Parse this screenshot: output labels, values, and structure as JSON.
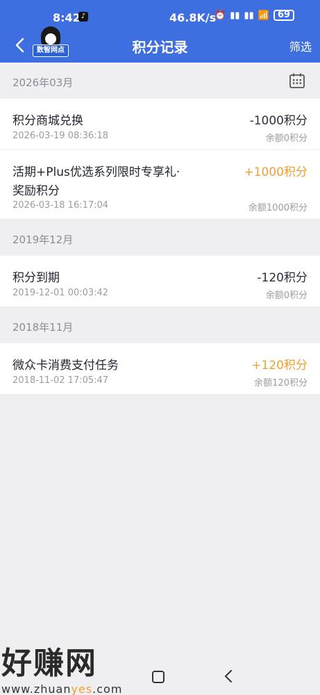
{
  "status_bar": {
    "time": "8:42",
    "network_speed": "46.8K/s",
    "battery": "69"
  },
  "header": {
    "title": "积分记录",
    "filter_label": "筛选",
    "logo_text": "数智网点"
  },
  "sections": [
    {
      "month": "2026年03月",
      "records": [
        {
          "title": "积分商城兑换",
          "date": "2026-03-19 08:36:18",
          "amount": "-1000积分",
          "balance": "余额0积分",
          "type": "negative"
        },
        {
          "title_line1": "活期+Plus优选系列限时专享礼·",
          "title_line2": "奖励积分",
          "date": "2026-03-18 16:17:04",
          "amount": "+1000积分",
          "balance": "余额1000积分",
          "type": "positive"
        }
      ]
    },
    {
      "month": "2019年12月",
      "records": [
        {
          "title": "积分到期",
          "date": "2019-12-01 00:03:42",
          "amount": "-120积分",
          "balance": "余额0积分",
          "type": "negative"
        }
      ]
    },
    {
      "month": "2018年11月",
      "records": [
        {
          "title": "微众卡消费支付任务",
          "date": "2018-11-02 17:05:47",
          "amount": "+120积分",
          "balance": "余额120积分",
          "type": "positive"
        }
      ]
    }
  ],
  "watermark": {
    "text": "好赚网",
    "url_prefix": "www.zhuan",
    "url_highlight": "yes",
    "url_suffix": ".com"
  },
  "colors": {
    "header_blue": "#3d6fe0",
    "positive": "#f0a030",
    "negative": "#2b2f3a"
  }
}
